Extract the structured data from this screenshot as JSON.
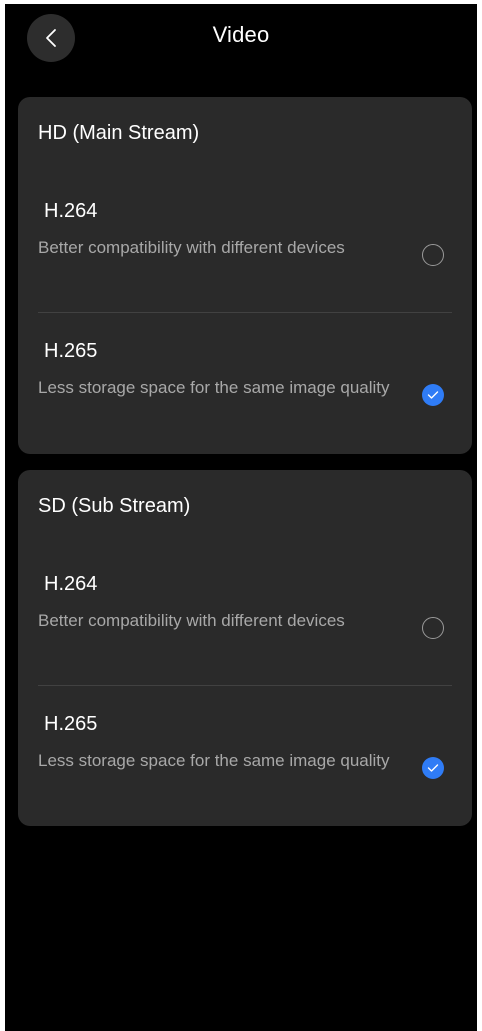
{
  "header": {
    "title": "Video",
    "back_icon": "chevron-left-icon"
  },
  "hd": {
    "title": "HD (Main Stream)",
    "options": [
      {
        "name": "H.264",
        "description": "Better compatibility with different devices",
        "selected": false
      },
      {
        "name": "H.265",
        "description": "Less storage space for the same image quality",
        "selected": true
      }
    ]
  },
  "sd": {
    "title": "SD (Sub Stream)",
    "options": [
      {
        "name": "H.264",
        "description": "Better compatibility with different devices",
        "selected": false
      },
      {
        "name": "H.265",
        "description": "Less storage space for the same image quality",
        "selected": true
      }
    ]
  },
  "colors": {
    "background": "#000000",
    "card": "#2a2a2a",
    "accent": "#2f7cf6",
    "secondary_text": "#a8a8a8"
  }
}
